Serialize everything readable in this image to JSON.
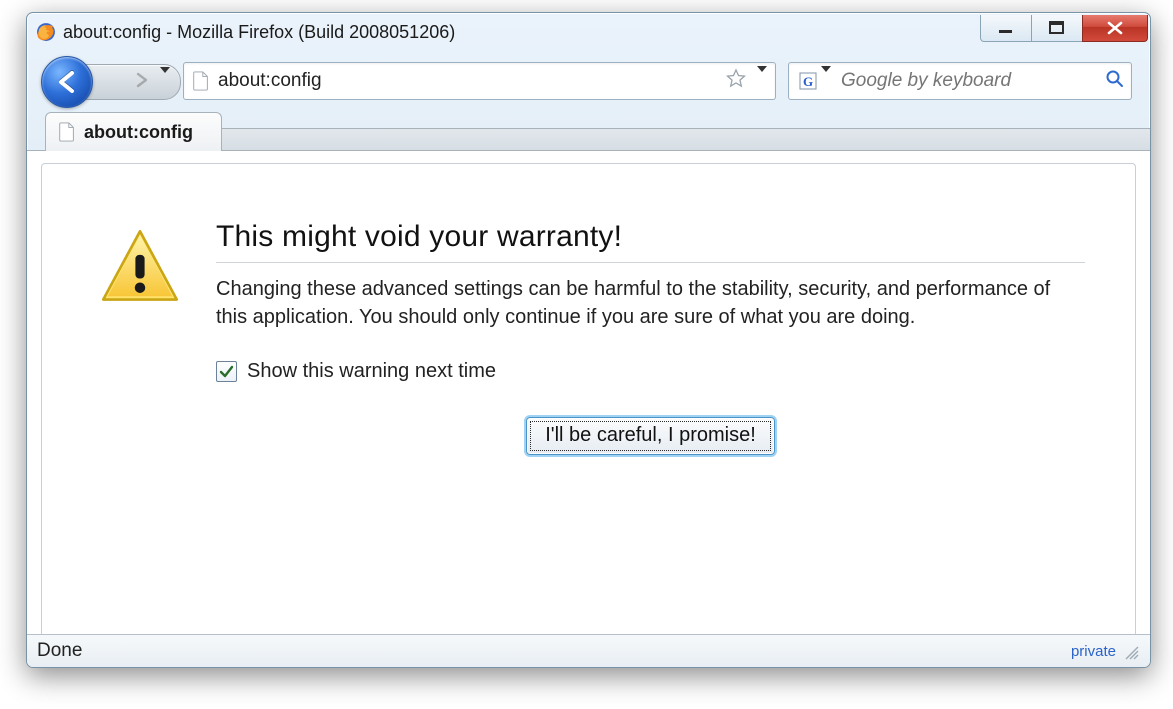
{
  "window": {
    "title": "about:config - Mozilla Firefox (Build 2008051206)"
  },
  "toolbar": {
    "url": "about:config",
    "search_placeholder": "Google by keyboard",
    "search_engine_letter": "G"
  },
  "tab": {
    "label": "about:config"
  },
  "warning": {
    "heading": "This might void your warranty!",
    "body": "Changing these advanced settings can be harmful to the stability, security, and performance of this application. You should only continue if you are sure of what you are doing.",
    "checkbox_label": "Show this warning next time",
    "checkbox_checked": true,
    "button_label": "I'll be careful, I promise!"
  },
  "statusbar": {
    "status": "Done",
    "private_label": "private"
  }
}
